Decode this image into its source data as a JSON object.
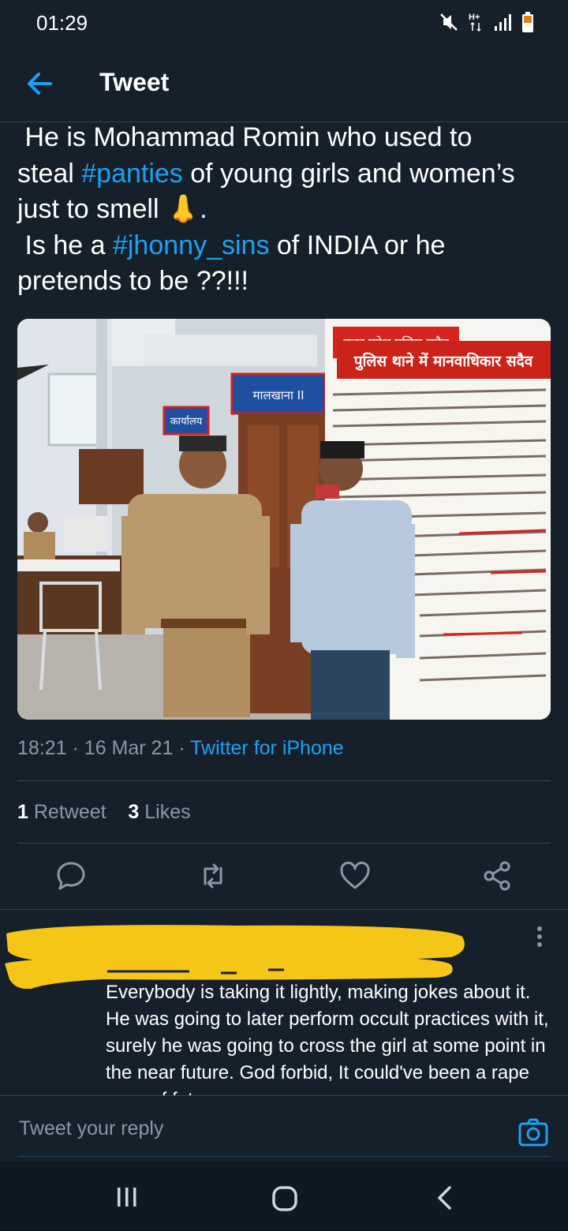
{
  "status_bar": {
    "time": "01:29",
    "icons": [
      "mute-icon",
      "network-hplus-icon",
      "signal-icon",
      "battery-icon"
    ]
  },
  "header": {
    "title": "Tweet",
    "back_icon": "arrow-left-icon"
  },
  "tweet": {
    "text_segments": {
      "s1": " He is Mohammad Romin who used to\nsteal ",
      "h1": "#panties",
      "s2": " of young girls and women’s\njust to smell ",
      "emoji": "👃",
      "s3": ".\n Is he a ",
      "h2": "#jhonny_sins",
      "s4": " of INDIA or he\npretends to be ??!!!"
    },
    "photo_signs": {
      "banner_top": "उत्तर प्रदेश पुलिस सदैव",
      "banner_main": "पुलिस थाने में मानवाधिकार सदैव",
      "door_sign": "मालखाना II",
      "room_sign": "कार्यालय"
    },
    "time": "18:21",
    "separator": "·",
    "date": "16 Mar 21",
    "source": "Twitter for iPhone",
    "stats": {
      "retweets_count": "1",
      "retweets_label": "Retweet",
      "likes_count": "3",
      "likes_label": "Likes"
    },
    "actions": [
      "reply-icon",
      "retweet-icon",
      "like-icon",
      "share-icon"
    ]
  },
  "reply": {
    "text": "Everybody is taking it lightly, making jokes about it. He was going to later perform occult practices with it, surely he was going to cross the girl at some point in the near future. God forbid, It could've been a rape case of future.",
    "redaction_color": "#f5c518"
  },
  "composer": {
    "placeholder": "Tweet your reply",
    "camera_icon": "camera-icon"
  },
  "nav": [
    "recents-icon",
    "home-icon",
    "back-icon"
  ],
  "colors": {
    "background": "#15202b",
    "accent": "#1da1f2",
    "secondary_text": "#8899a6",
    "divider": "#38444d"
  }
}
